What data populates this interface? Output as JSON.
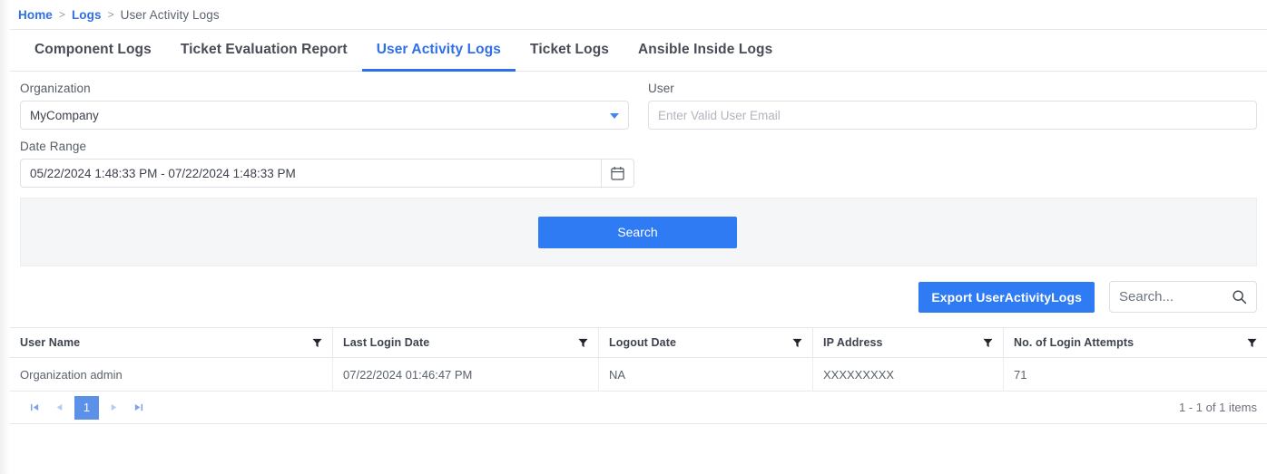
{
  "breadcrumb": {
    "items": [
      {
        "label": "Home",
        "type": "link"
      },
      {
        "label": "Logs",
        "type": "link"
      },
      {
        "label": "User Activity Logs",
        "type": "current"
      }
    ],
    "separator": ">"
  },
  "tabs": [
    {
      "label": "Component Logs",
      "active": false
    },
    {
      "label": "Ticket Evaluation Report",
      "active": false
    },
    {
      "label": "User Activity Logs",
      "active": true
    },
    {
      "label": "Ticket Logs",
      "active": false
    },
    {
      "label": "Ansible Inside Logs",
      "active": false
    }
  ],
  "filters": {
    "organization": {
      "label": "Organization",
      "value": "MyCompany",
      "icon": "chevron-down-icon"
    },
    "user": {
      "label": "User",
      "value": "",
      "placeholder": "Enter Valid User Email"
    },
    "date_range": {
      "label": "Date Range",
      "value": "05/22/2024 1:48:33 PM - 07/22/2024 1:48:33 PM",
      "icon": "calendar-icon"
    },
    "search_button": "Search"
  },
  "toolbar": {
    "export_label": "Export UserActivityLogs",
    "search_placeholder": "Search...",
    "search_value": "",
    "search_icon": "search-icon"
  },
  "table": {
    "columns": [
      {
        "label": "User Name",
        "filter_icon": "filter-funnel-icon"
      },
      {
        "label": "Last Login Date",
        "filter_icon": "filter-funnel-icon"
      },
      {
        "label": "Logout Date",
        "filter_icon": "filter-funnel-icon"
      },
      {
        "label": "IP Address",
        "filter_icon": "filter-funnel-icon"
      },
      {
        "label": "No. of Login Attempts",
        "filter_icon": "filter-funnel-icon"
      }
    ],
    "rows": [
      {
        "user_name": "Organization admin",
        "last_login_date": "07/22/2024 01:46:47 PM",
        "logout_date": "NA",
        "ip_address": "XXXXXXXXX",
        "login_attempts": "71"
      }
    ]
  },
  "pager": {
    "first": "⏮",
    "prev": "◀",
    "current_page": "1",
    "next": "▶",
    "last": "⏭",
    "count_text": "1 - 1 of 1 items"
  },
  "colors": {
    "accent": "#2f7bf3",
    "link": "#2f6fe8",
    "band": "#f5f6f8",
    "pager_active": "#5b91e8"
  }
}
